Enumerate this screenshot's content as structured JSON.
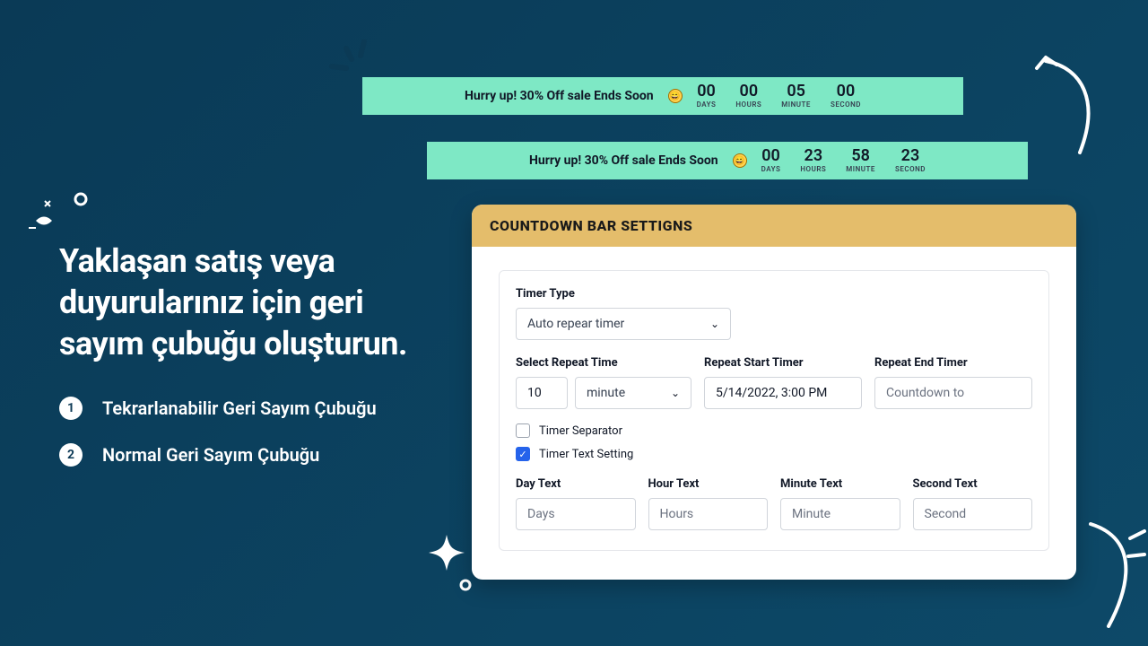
{
  "bars": [
    {
      "message": "Hurry up! 30% Off sale Ends Soon",
      "units": [
        {
          "value": "00",
          "label": "DAYS"
        },
        {
          "value": "00",
          "label": "HOURS"
        },
        {
          "value": "05",
          "label": "MINUTE"
        },
        {
          "value": "00",
          "label": "SECOND"
        }
      ]
    },
    {
      "message": "Hurry up! 30% Off sale Ends Soon",
      "units": [
        {
          "value": "00",
          "label": "DAYS"
        },
        {
          "value": "23",
          "label": "HOURS"
        },
        {
          "value": "58",
          "label": "MINUTE"
        },
        {
          "value": "23",
          "label": "SECOND"
        }
      ]
    }
  ],
  "left": {
    "headline": "Yaklaşan satış veya duyurularınız için geri sayım çubuğu oluşturun.",
    "items": [
      {
        "num": "1",
        "label": "Tekrarlanabilir Geri Sayım Çubuğu"
      },
      {
        "num": "2",
        "label": "Normal Geri Sayım Çubuğu"
      }
    ]
  },
  "panel": {
    "title": "COUNTDOWN BAR SETTIGNS",
    "timer_type_label": "Timer Type",
    "timer_type_value": "Auto repear timer",
    "select_repeat_label": "Select Repeat Time",
    "repeat_value": "10",
    "repeat_unit": "minute",
    "repeat_start_label": "Repeat Start Timer",
    "repeat_start_value": "5/14/2022, 3:00 PM",
    "repeat_end_label": "Repeat End Timer",
    "repeat_end_placeholder": "Countdown to",
    "timer_separator_label": "Timer Separator",
    "timer_text_setting_label": "Timer Text Setting",
    "day_text_label": "Day Text",
    "day_text_value": "Days",
    "hour_text_label": "Hour Text",
    "hour_text_value": "Hours",
    "minute_text_label": "Minute Text",
    "minute_text_value": "Minute",
    "second_text_label": "Second Text",
    "second_text_value": "Second"
  }
}
